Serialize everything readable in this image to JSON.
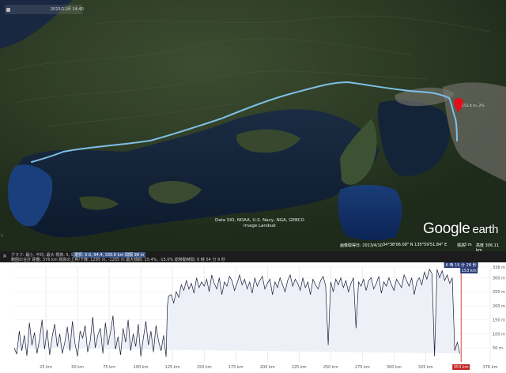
{
  "map": {
    "timestamp": "2015/11月 14:40",
    "attribution": [
      "Data SIO, NOAA, U.S. Navy, NGA, GEBCO",
      "Image Landsat"
    ],
    "logo": {
      "brand": "Google",
      "product": "earth"
    },
    "statusbar": {
      "date": "画像取得日: 2013/4/10",
      "coords": "34°38'06.08\" N  135°59'51.84\" E",
      "elevation_label": "標高",
      "elevation": "3 m",
      "eye_alt": "高度 306.11 km"
    },
    "pin_label": "153.4 m, 2%"
  },
  "stats": {
    "line1_a": "グラフ: 最小, 平均, 最大 標高: 5, 99, 338 m",
    "line1_b": "選択: 0.0, 94.4, 330.6 km 間隔 98 m",
    "line2": "範囲の合計 距離: 376 km 標高の上昇/下降: 1295 m, -1265 m  最大傾斜: 15.4%, -15.0%  総移動時間: 6 時 54 分 9 秒"
  },
  "profile": {
    "cursor_label": "6 時 19 分 28 秒",
    "cursor_value": "153 km",
    "cursor_xbadge": "353 km"
  },
  "chart_data": {
    "type": "area",
    "title": "",
    "xlabel": "",
    "ylabel": "",
    "xlim": [
      0,
      376
    ],
    "ylim": [
      0,
      338
    ],
    "x_ticks": [
      "25 km",
      "50 km",
      "75 km",
      "100 km",
      "125 km",
      "150 km",
      "175 km",
      "200 km",
      "225 km",
      "250 km",
      "275 km",
      "300 km",
      "325 km",
      "353 km",
      "376 km"
    ],
    "x_tick_values": [
      25,
      50,
      75,
      100,
      125,
      150,
      175,
      200,
      225,
      250,
      275,
      300,
      325,
      353,
      376
    ],
    "y_ticks": [
      "50 m",
      "100 m",
      "150 m",
      "200 m",
      "250 m",
      "300 m",
      "338 m"
    ],
    "y_tick_values": [
      50,
      100,
      150,
      200,
      250,
      300,
      338
    ],
    "x": [
      0,
      2,
      4,
      6,
      8,
      10,
      12,
      14,
      16,
      18,
      20,
      22,
      24,
      26,
      28,
      30,
      32,
      34,
      36,
      38,
      40,
      42,
      44,
      46,
      48,
      50,
      52,
      54,
      56,
      58,
      60,
      62,
      64,
      66,
      68,
      70,
      72,
      74,
      76,
      78,
      80,
      82,
      84,
      86,
      88,
      90,
      92,
      94,
      96,
      98,
      100,
      102,
      104,
      106,
      108,
      110,
      112,
      114,
      116,
      118,
      120,
      121,
      122,
      124,
      126,
      128,
      130,
      132,
      134,
      136,
      138,
      140,
      142,
      144,
      146,
      148,
      150,
      152,
      154,
      156,
      158,
      160,
      162,
      164,
      166,
      168,
      170,
      172,
      174,
      176,
      178,
      180,
      182,
      184,
      186,
      188,
      190,
      192,
      194,
      196,
      198,
      200,
      202,
      204,
      206,
      208,
      210,
      212,
      214,
      216,
      218,
      220,
      222,
      224,
      226,
      228,
      230,
      232,
      234,
      236,
      238,
      240,
      242,
      244,
      246,
      248,
      250,
      252,
      254,
      256,
      258,
      260,
      262,
      264,
      266,
      268,
      270,
      272,
      274,
      276,
      278,
      280,
      282,
      284,
      286,
      288,
      290,
      292,
      294,
      296,
      298,
      300,
      302,
      304,
      306,
      308,
      310,
      312,
      314,
      316,
      318,
      320,
      322,
      324,
      326,
      328,
      330,
      332,
      334,
      336,
      338,
      340,
      342,
      344,
      346,
      348,
      350,
      352,
      354,
      356,
      358,
      360,
      362,
      364,
      366,
      368,
      370,
      372,
      374,
      376
    ],
    "values": [
      50,
      28,
      110,
      40,
      95,
      22,
      140,
      60,
      105,
      30,
      80,
      150,
      45,
      115,
      25,
      90,
      135,
      55,
      100,
      30,
      70,
      125,
      40,
      145,
      65,
      20,
      110,
      85,
      130,
      35,
      75,
      160,
      50,
      95,
      120,
      30,
      140,
      60,
      105,
      165,
      45,
      90,
      25,
      120,
      70,
      150,
      40,
      100,
      55,
      135,
      20,
      85,
      145,
      60,
      110,
      35,
      130,
      75,
      40,
      95,
      18,
      200,
      235,
      240,
      210,
      250,
      230,
      275,
      255,
      290,
      260,
      280,
      245,
      300,
      265,
      285,
      270,
      295,
      250,
      310,
      280,
      260,
      300,
      240,
      285,
      270,
      305,
      290,
      255,
      280,
      310,
      275,
      295,
      260,
      285,
      245,
      300,
      270,
      290,
      305,
      260,
      280,
      295,
      240,
      285,
      265,
      300,
      275,
      250,
      290,
      310,
      270,
      295,
      280,
      255,
      300,
      265,
      285,
      240,
      295,
      275,
      260,
      290,
      305,
      270,
      60,
      285,
      250,
      295,
      275,
      300,
      265,
      290,
      250,
      280,
      300,
      120,
      285,
      270,
      295,
      255,
      290,
      300,
      260,
      280,
      305,
      245,
      285,
      270,
      300,
      275,
      255,
      295,
      280,
      265,
      310,
      290,
      270,
      300,
      240,
      285,
      300,
      275,
      320,
      295,
      330,
      315,
      20,
      330,
      300,
      325,
      290,
      310,
      280,
      300,
      40,
      70,
      30
    ]
  }
}
